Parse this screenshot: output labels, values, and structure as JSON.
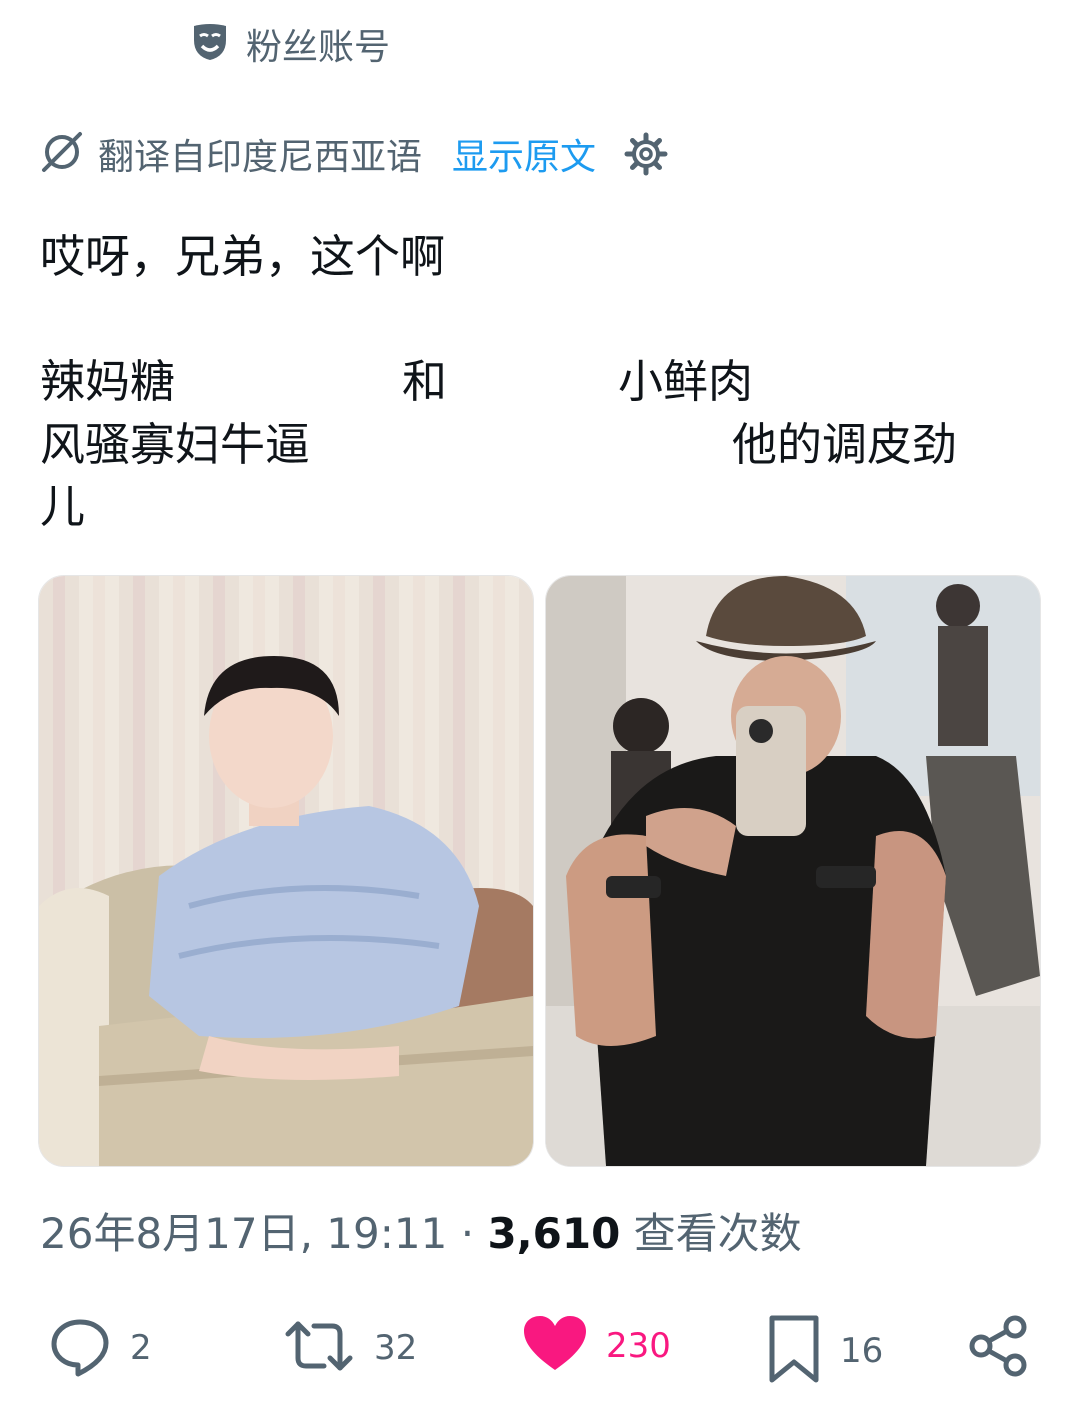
{
  "header": {
    "badge_icon": "mask-icon",
    "badge_text": "粉丝账号"
  },
  "translation": {
    "icon": "translate-icon",
    "label": "翻译自印度尼西亚语",
    "show_original": "显示原文",
    "settings_icon": "gear-icon"
  },
  "post": {
    "line1": "哎呀，兄弟，这个啊",
    "line2_a": "辣妈糖",
    "line2_b": "和",
    "line2_c": "小鲜肉",
    "line3_a": "风骚寡妇牛逼",
    "line3_b": "他的调皮劲",
    "line4": "儿"
  },
  "media": [
    {
      "name": "photo-left"
    },
    {
      "name": "photo-right"
    }
  ],
  "meta": {
    "timestamp": "26年8月17日, 19:11",
    "separator": "·",
    "views_count": "3,610",
    "views_label": "查看次数"
  },
  "actions": {
    "reply_count": "2",
    "repost_count": "32",
    "like_count": "230",
    "bookmark_count": "16",
    "like_color": "#f91880",
    "link_color": "#1d9bf0",
    "secondary_color": "#536471"
  }
}
